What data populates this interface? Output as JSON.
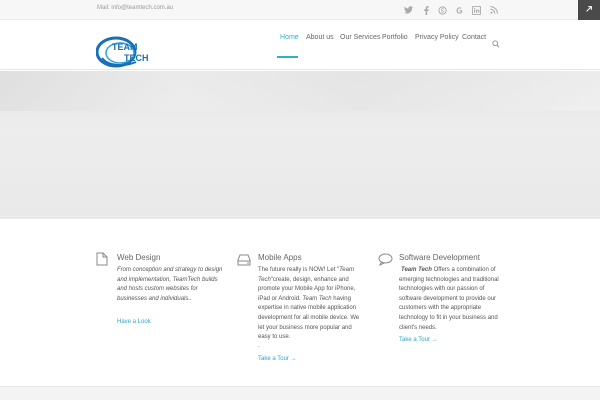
{
  "topbar": {
    "mail": "Mail: info@teamtech.com.au",
    "social_icons": [
      "twitter-icon",
      "facebook-icon",
      "skype-icon",
      "google-plus-icon",
      "linkedin-icon",
      "rss-icon"
    ]
  },
  "logo": {
    "line1": "TEAM",
    "line2": "TECH",
    "color": "#1a6fb5"
  },
  "nav": {
    "items": [
      "Home",
      "About us",
      "Our Services",
      "Portfolio",
      "Privacy Policy",
      "Contact"
    ],
    "active_color": "#2fb0c5"
  },
  "services": {
    "web": {
      "title": "Web Design",
      "text": "From conception and strategy to design and implementation, TeamTech builds and hosts custom websites for businesses and individuals..",
      "link": "Have a Look"
    },
    "mobile": {
      "title": "Mobile Apps",
      "text_a": "The future really is NOW! Let \"",
      "text_b": "Team Tech",
      "text_c": "\"create, design, enhance and promote your Mobile App for iPhone, iPad or Android. ",
      "text_d": "Team Tech",
      "text_e": " having expertise in native mobile application development for all mobile device. We let your business more popular and easy to use.",
      "dot": ".",
      "link": "Take a Tour →"
    },
    "software": {
      "title": "Software Development",
      "text_a": "Team Tech",
      "text_b": " Offers a combination of emerging technologies and traditional technologies with our passion of software development to provide our customers with the appropriate technology to fit in your business and client's needs.",
      "link": "Take a Tour →"
    }
  }
}
